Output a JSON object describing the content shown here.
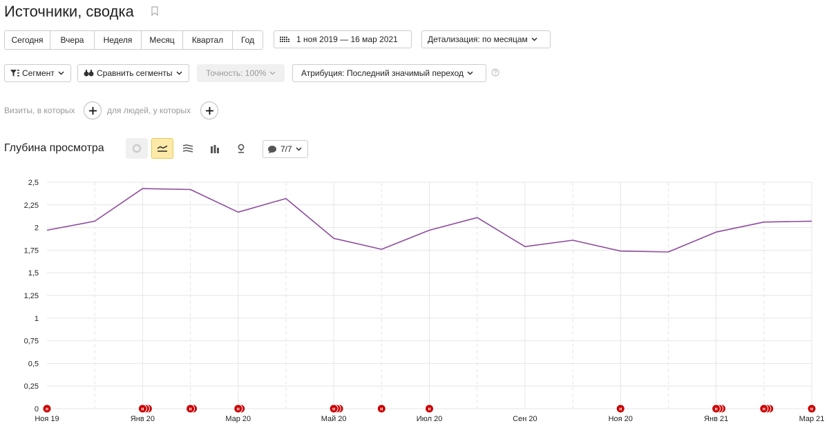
{
  "header": {
    "title": "Источники, сводка"
  },
  "period_buttons": [
    {
      "label": "Сегодня",
      "w": 66
    },
    {
      "label": "Вчера",
      "w": 64
    },
    {
      "label": "Неделя",
      "w": 68
    },
    {
      "label": "Месяц",
      "w": 60
    },
    {
      "label": "Квартал",
      "w": 72
    },
    {
      "label": "Год",
      "w": 43
    }
  ],
  "date_range": {
    "label": "1 ноя 2019 — 16 мар 2021"
  },
  "detail": {
    "label": "Детализация: по месяцам"
  },
  "toolbar": {
    "segment_label": "Сегмент",
    "compare_label": "Сравнить сегменты",
    "accuracy_label": "Точность: 100%",
    "attribution_label": "Атрибуция: Последний значимый переход"
  },
  "segment_builder": {
    "visits_label": "Визиты, в которых",
    "people_label": "для людей, у которых"
  },
  "metric": {
    "title": "Глубина просмотра",
    "notes_label": "7/7"
  },
  "colors": {
    "line": "#8e4a9e",
    "marker": "#cc0000",
    "grid": "#e5e5e5",
    "active_view": "#fdeaa8"
  },
  "chart_data": {
    "type": "line",
    "x_ticks": [
      "Ноя 19",
      "Янв 20",
      "Мар 20",
      "Май 20",
      "Июл 20",
      "Сен 20",
      "Ноя 20",
      "Янв 21",
      "Мар 21"
    ],
    "y_ticks": [
      "0",
      "0,25",
      "0,5",
      "0,75",
      "1",
      "1,25",
      "1,5",
      "1,75",
      "2",
      "2,25",
      "2,5"
    ],
    "ylim": [
      0,
      2.5
    ],
    "x": [
      "2019-11",
      "2019-12",
      "2020-01",
      "2020-02",
      "2020-03",
      "2020-04",
      "2020-05",
      "2020-06",
      "2020-07",
      "2020-08",
      "2020-09",
      "2020-10",
      "2020-11",
      "2020-12",
      "2021-01",
      "2021-02",
      "2021-03"
    ],
    "values": [
      1.97,
      2.07,
      2.43,
      2.42,
      2.17,
      2.32,
      1.88,
      1.76,
      1.97,
      2.11,
      1.79,
      1.86,
      1.74,
      1.73,
      1.95,
      2.06,
      2.07
    ],
    "annotation_marker": "н",
    "annotations": [
      {
        "month": 0,
        "count": 1
      },
      {
        "month": 2,
        "count": 3
      },
      {
        "month": 3,
        "count": 2
      },
      {
        "month": 4,
        "count": 2
      },
      {
        "month": 6,
        "count": 3
      },
      {
        "month": 7,
        "count": 1
      },
      {
        "month": 8,
        "count": 1
      },
      {
        "month": 12,
        "count": 1
      },
      {
        "month": 14,
        "count": 3
      },
      {
        "month": 15,
        "count": 3
      },
      {
        "month": 16,
        "count": 1
      }
    ],
    "grid": true
  }
}
